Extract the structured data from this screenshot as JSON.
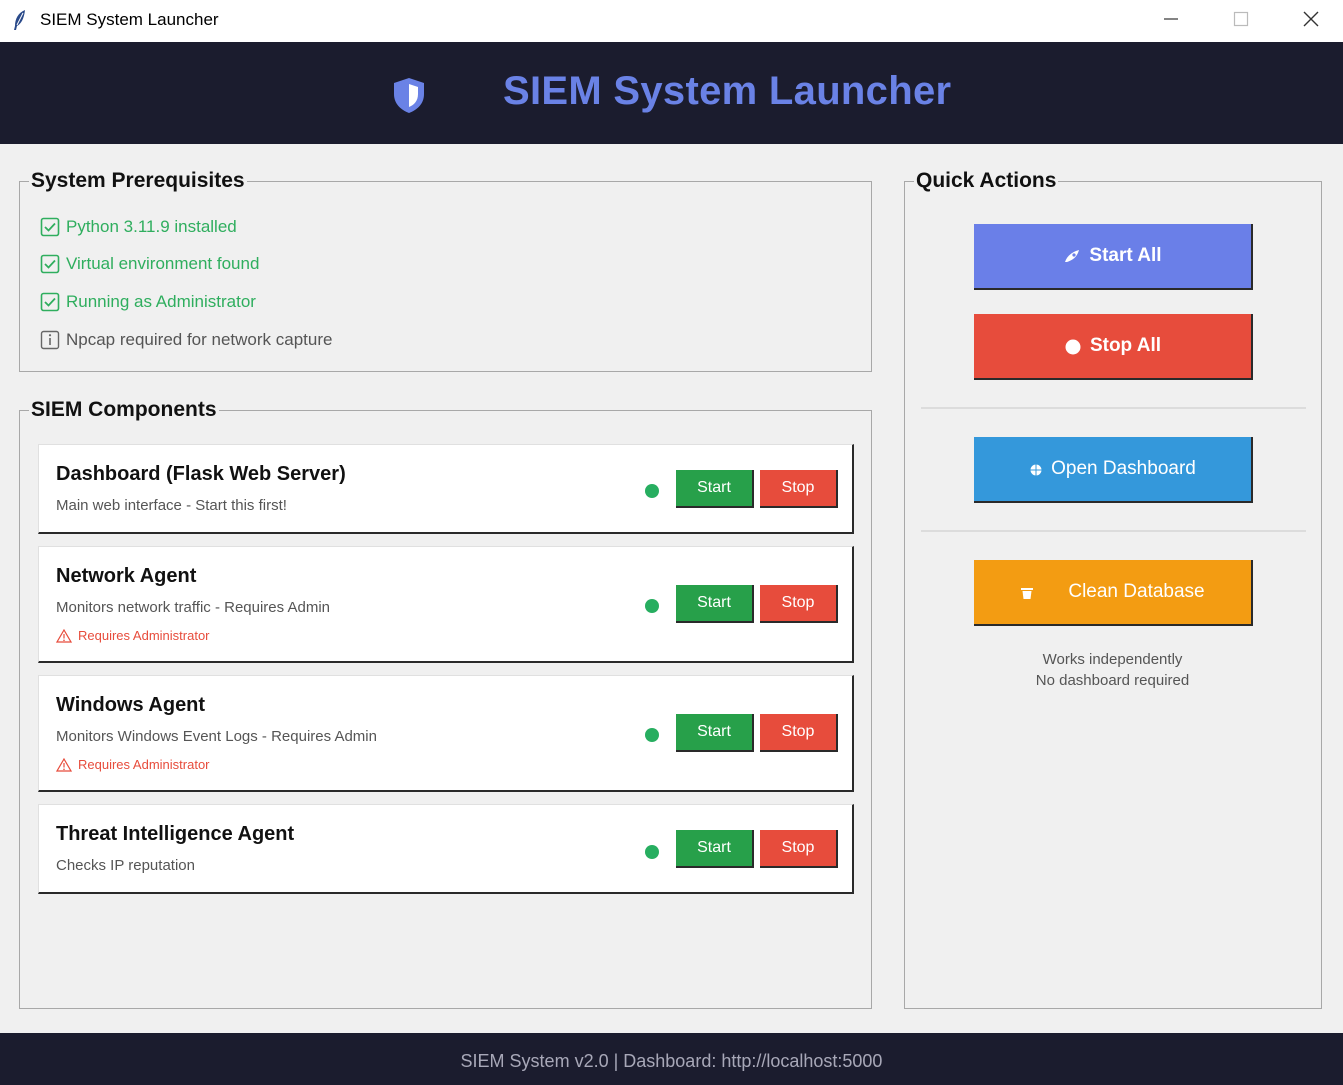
{
  "window": {
    "title": "SIEM System Launcher",
    "app_icon": "feather-icon",
    "controls": [
      "minimize-icon",
      "maximize-icon",
      "close-icon"
    ]
  },
  "header": {
    "icon": "shield-icon",
    "title": "SIEM System Launcher",
    "accent_color": "#6a82e6",
    "background": "#1b1c2e"
  },
  "prerequisites": {
    "title": "System Prerequisites",
    "items": [
      {
        "text": "Python 3.11.9 installed",
        "status": "ok",
        "icon": "check-box-icon"
      },
      {
        "text": "Virtual environment found",
        "status": "ok",
        "icon": "check-box-icon"
      },
      {
        "text": "Running as Administrator",
        "status": "ok",
        "icon": "check-box-icon"
      },
      {
        "text": "Npcap required for network capture",
        "status": "info",
        "icon": "info-icon"
      }
    ]
  },
  "components": {
    "title": "SIEM Components",
    "start_label": "Start",
    "stop_label": "Stop",
    "items": [
      {
        "name": "Dashboard (Flask Web Server)",
        "description": "Main web interface - Start this first!",
        "warning": ""
      },
      {
        "name": "Network Agent",
        "description": "Monitors network traffic - Requires Admin",
        "warning": "Requires Administrator"
      },
      {
        "name": "Windows Agent",
        "description": "Monitors Windows Event Logs - Requires Admin",
        "warning": "Requires Administrator"
      },
      {
        "name": "Threat Intelligence Agent",
        "description": "Checks IP reputation",
        "warning": ""
      }
    ]
  },
  "quick_actions": {
    "title": "Quick Actions",
    "start_all": "Start All",
    "stop_all": "Stop All",
    "open_dashboard": "Open Dashboard",
    "clean_database": "Clean Database",
    "note_line1": "Works independently",
    "note_line2": "No dashboard required"
  },
  "footer": {
    "text": "SIEM System v2.0 | Dashboard: http://localhost:5000"
  },
  "colors": {
    "ok_green": "#2fae5e",
    "start_green": "#27a04a",
    "stop_red": "#e74c3c",
    "start_all_blue": "#6a7fe8",
    "dashboard_blue": "#3498db",
    "clean_orange": "#f39c12",
    "status_dot": "#27ae60"
  }
}
